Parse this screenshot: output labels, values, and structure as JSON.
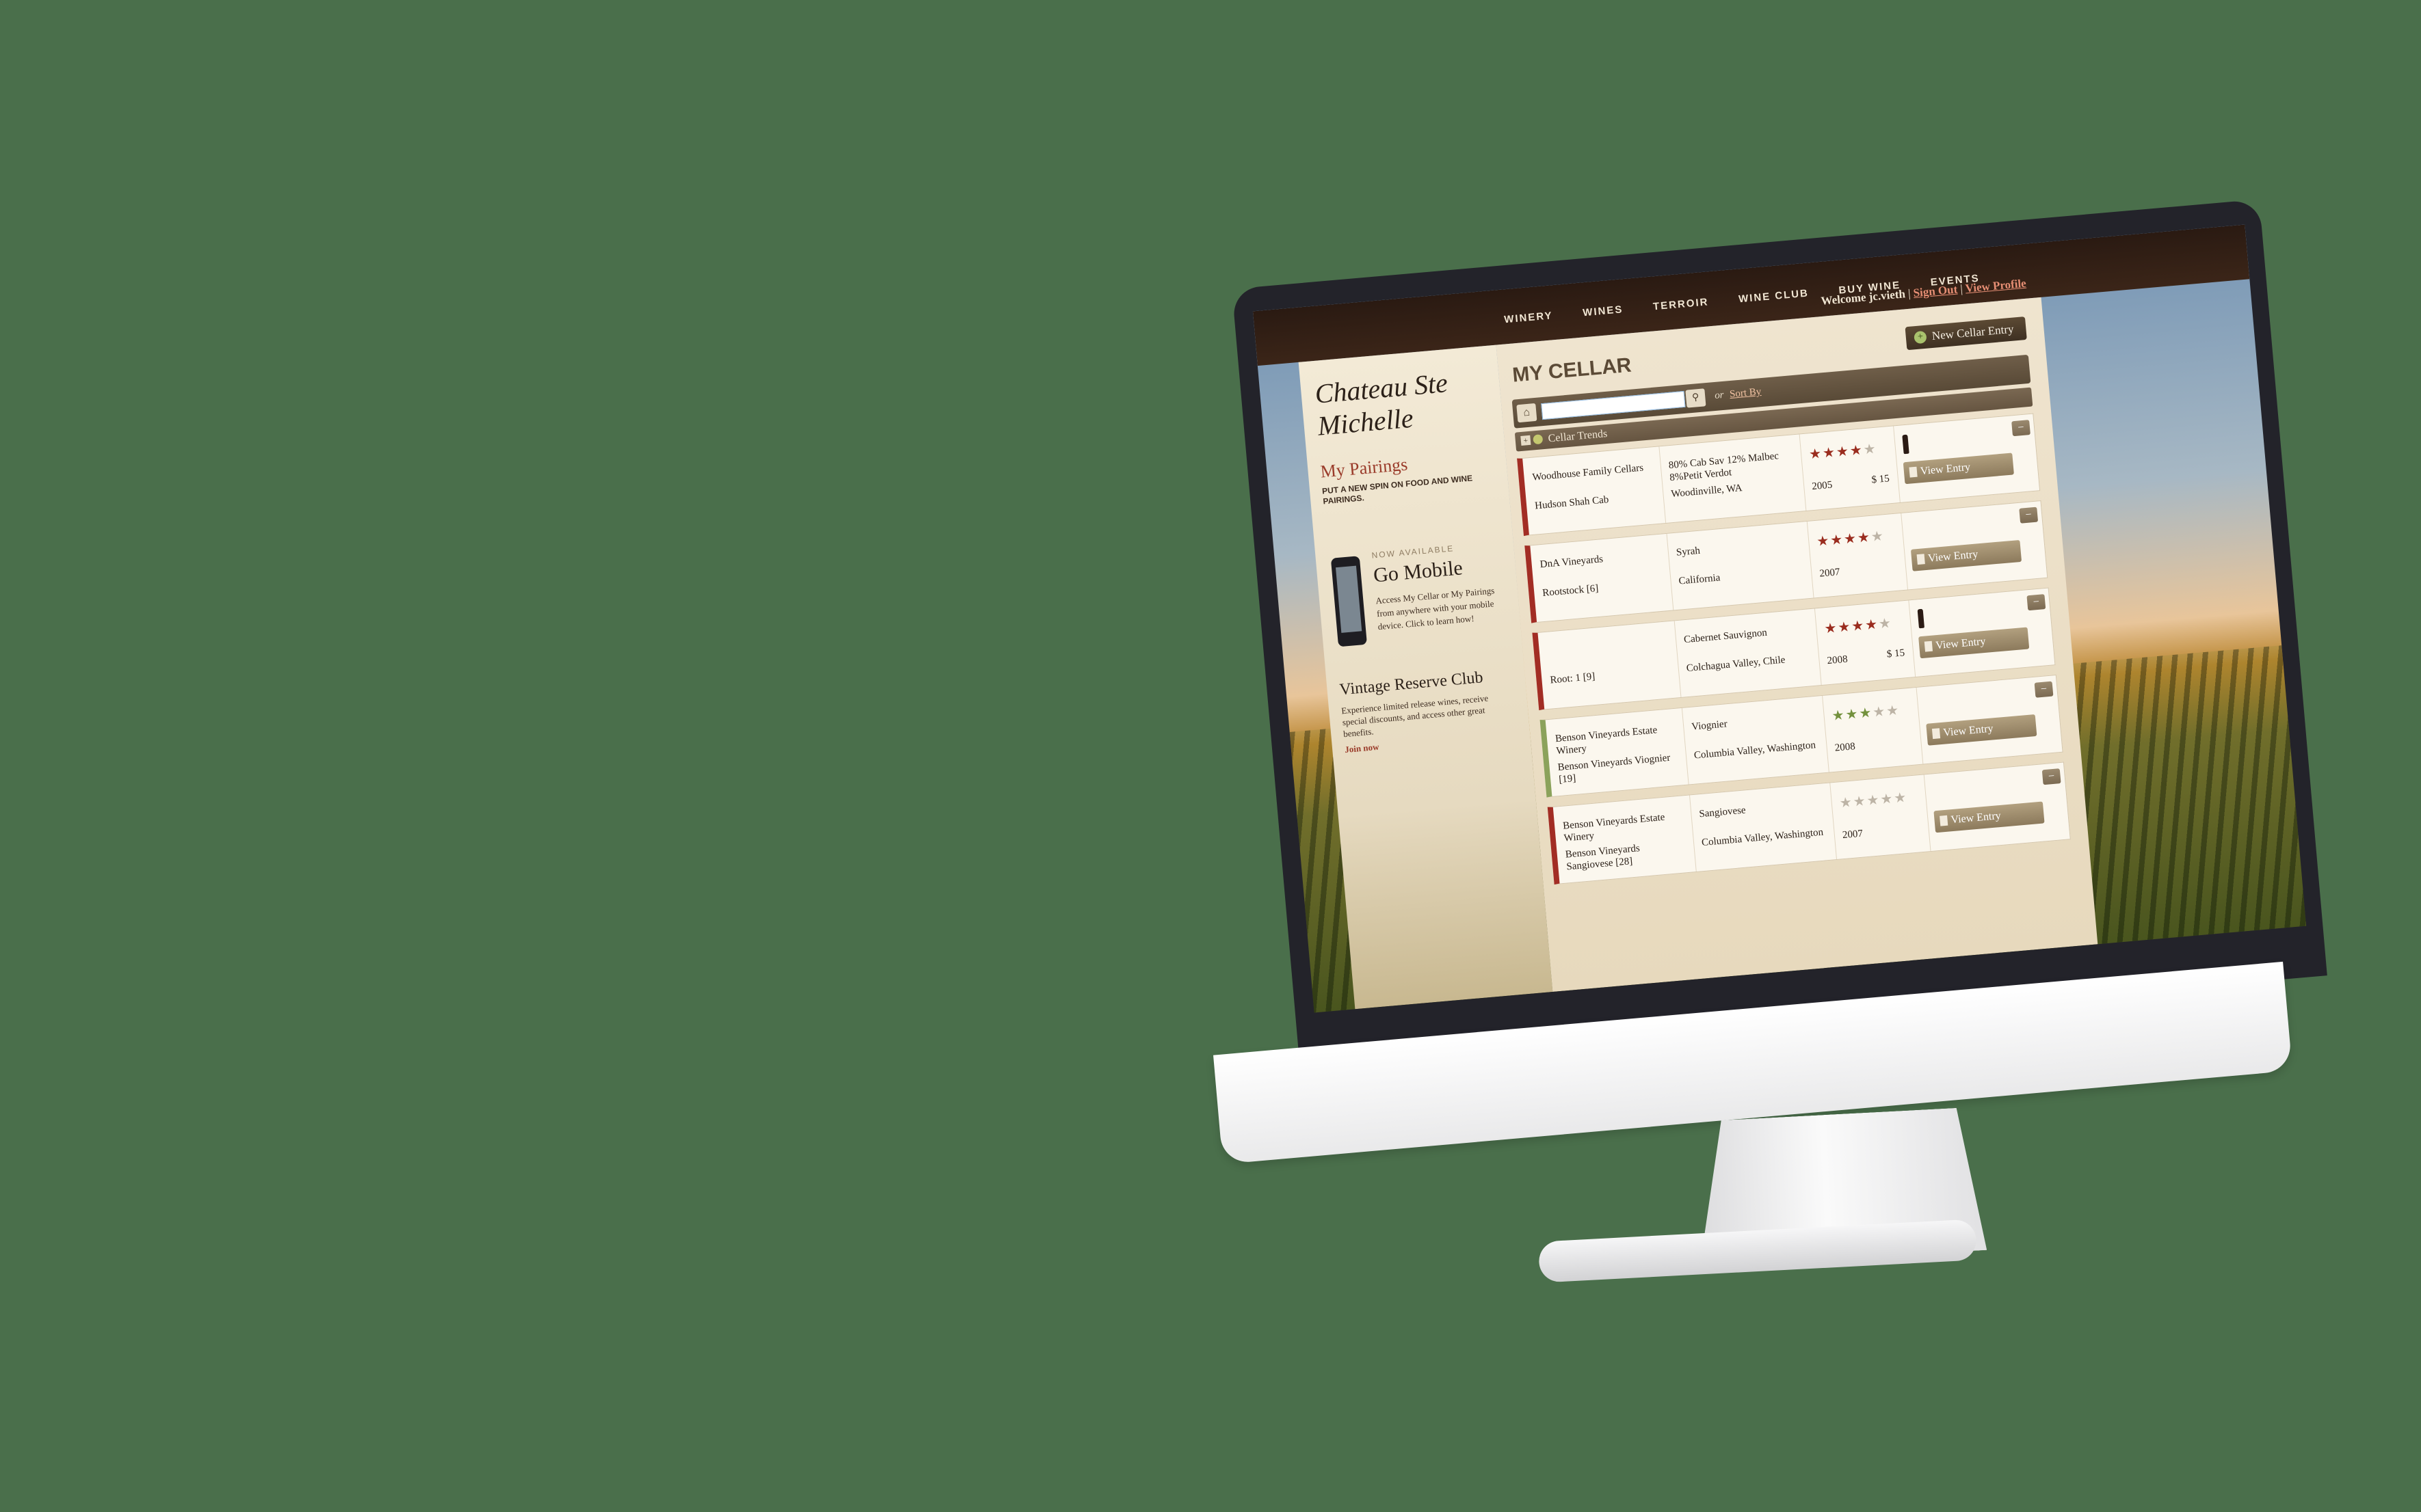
{
  "nav": [
    "WINERY",
    "WINES",
    "TERROIR",
    "WINE CLUB",
    "BUY WINE",
    "EVENTS"
  ],
  "header": {
    "welcome": "Welcome jc.vieth",
    "separator": "|",
    "sign_out": "Sign Out",
    "view_profile": "View Profile"
  },
  "sidebar": {
    "logo": "Chateau Ste Michelle",
    "pairings_title": "My Pairings",
    "pairings_sub": "PUT A NEW SPIN ON FOOD AND WINE PAIRINGS.",
    "now_available": "NOW AVAILABLE",
    "go_mobile": "Go Mobile",
    "mobile_desc": "Access My Cellar or My Pairings from anywhere with your mobile device. Click to learn how!",
    "club_title": "Vintage Reserve Club",
    "club_desc": "Experience limited release wines, receive special discounts, and access other great benefits.",
    "join": "Join now"
  },
  "cellar": {
    "title": "MY CELLAR",
    "new_entry": "New Cellar Entry",
    "new_entry_icon": "plus-circle-icon",
    "search_value": "",
    "sort_or": "or",
    "sort_by": "Sort By",
    "trends_label": "Cellar Trends",
    "collapse_label": "−",
    "view_entry_label": "View Entry"
  },
  "rows": [
    {
      "producer": "Woodhouse Family Cellars",
      "wine": "Hudson Shah Cab",
      "varietal": "80% Cab Sav 12% Malbec 8%Petit Verdot",
      "region": "Woodinville, WA",
      "rating": 4,
      "vintage": "2005",
      "price": "$ 15",
      "bottle": true,
      "type": "red"
    },
    {
      "producer": "DnA Vineyards",
      "wine": "Rootstock [6]",
      "varietal": "Syrah",
      "region": "California",
      "rating": 4,
      "vintage": "2007",
      "price": "",
      "bottle": false,
      "type": "red"
    },
    {
      "producer": "",
      "wine": "Root: 1 [9]",
      "varietal": "Cabernet Sauvignon",
      "region": "Colchagua Valley, Chile",
      "rating": 4,
      "vintage": "2008",
      "price": "$ 15",
      "bottle": true,
      "type": "red"
    },
    {
      "producer": "Benson Vineyards Estate Winery",
      "wine": "Benson Vineyards Viognier [19]",
      "varietal": "Viognier",
      "region": "Columbia Valley, Washington",
      "rating": 3,
      "vintage": "2008",
      "price": "",
      "bottle": false,
      "type": "white"
    },
    {
      "producer": "Benson Vineyards Estate Winery",
      "wine": "Benson Vineyards Sangiovese [28]",
      "varietal": "Sangiovese",
      "region": "Columbia Valley, Washington",
      "rating": 0,
      "vintage": "2007",
      "price": "",
      "bottle": false,
      "type": "red"
    }
  ]
}
